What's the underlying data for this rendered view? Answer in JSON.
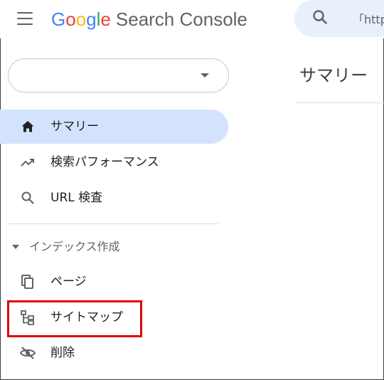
{
  "header": {
    "logo": {
      "letters": [
        "G",
        "o",
        "o",
        "g",
        "l",
        "e"
      ],
      "product": "Search Console"
    },
    "search": {
      "placeholder": "「http"
    }
  },
  "property_selector": {
    "value": ""
  },
  "main": {
    "page_title": "サマリー"
  },
  "sidebar": {
    "items": [
      {
        "label": "サマリー",
        "icon": "home-icon",
        "active": true
      },
      {
        "label": "検索パフォーマンス",
        "icon": "trending-up-icon",
        "active": false
      },
      {
        "label": "URL 検査",
        "icon": "search-icon",
        "active": false
      }
    ],
    "index_section": {
      "label": "インデックス作成",
      "items": [
        {
          "label": "ページ",
          "icon": "pages-icon"
        },
        {
          "label": "サイトマップ",
          "icon": "sitemap-icon"
        },
        {
          "label": "削除",
          "icon": "removals-icon"
        }
      ]
    }
  },
  "colors": {
    "accent_active_bg": "#d3e3fd",
    "highlight_border": "#e00000",
    "search_bg": "#eaf0fb"
  }
}
